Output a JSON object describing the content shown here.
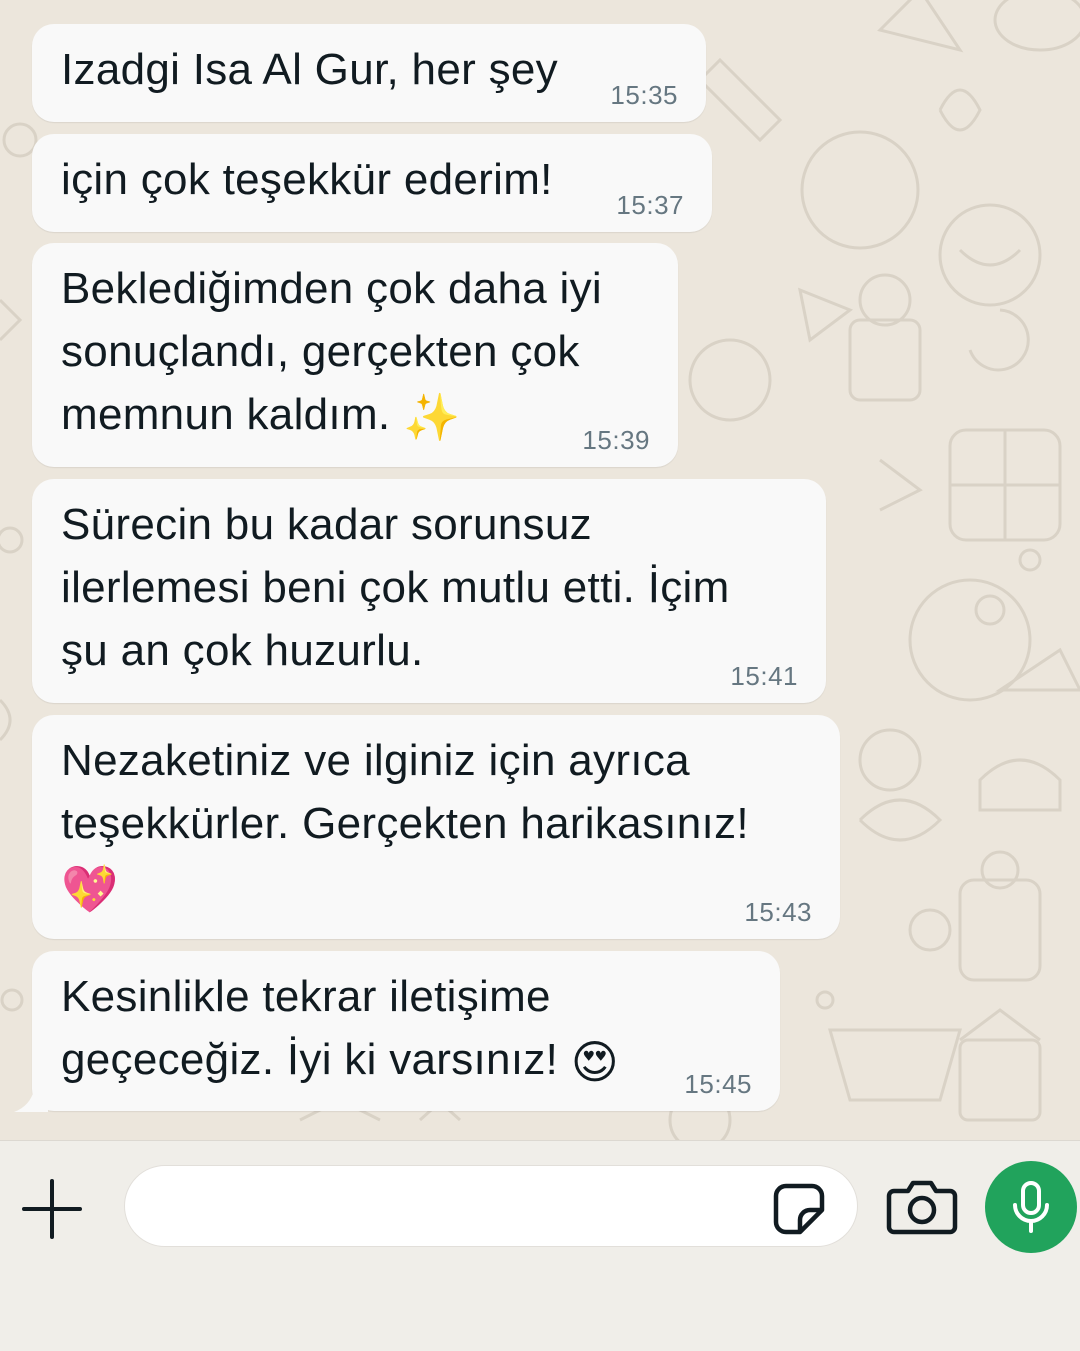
{
  "messages": [
    {
      "text": "Izadgi Isa Al Gur, her şey",
      "time": "15:35",
      "emoji": ""
    },
    {
      "text": "için çok teşekkür ederim!",
      "time": "15:37",
      "emoji": ""
    },
    {
      "text": "Beklediğimden çok daha iyi\nsonuçlandı, gerçekten çok\nmemnun kaldım. ",
      "time": "15:39",
      "emoji": "✨"
    },
    {
      "text": "Sürecin bu kadar sorunsuz\nilerlemesi beni çok mutlu etti. İçim\nşu an çok huzurlu.",
      "time": "15:41",
      "emoji": ""
    },
    {
      "text": "Nezaketiniz ve ilginiz için ayrıca\nteşekkürler. Gerçekten harikasınız!\n",
      "time": "15:43",
      "emoji": "💖"
    },
    {
      "text": "Kesinlikle tekrar iletişime\ngeçeceğiz. İyi ki varsınız! ",
      "time": "15:45",
      "emoji": "😍"
    }
  ],
  "composer": {
    "placeholder": "",
    "attach_icon": "plus-icon",
    "sticker_icon": "sticker-icon",
    "camera_icon": "camera-icon",
    "mic_icon": "microphone-icon",
    "mic_color": "#21a35c"
  },
  "colors": {
    "chat_background": "#ece6dc",
    "bubble": "#f9f9f9",
    "text": "#111b21",
    "timestamp": "#667781"
  }
}
